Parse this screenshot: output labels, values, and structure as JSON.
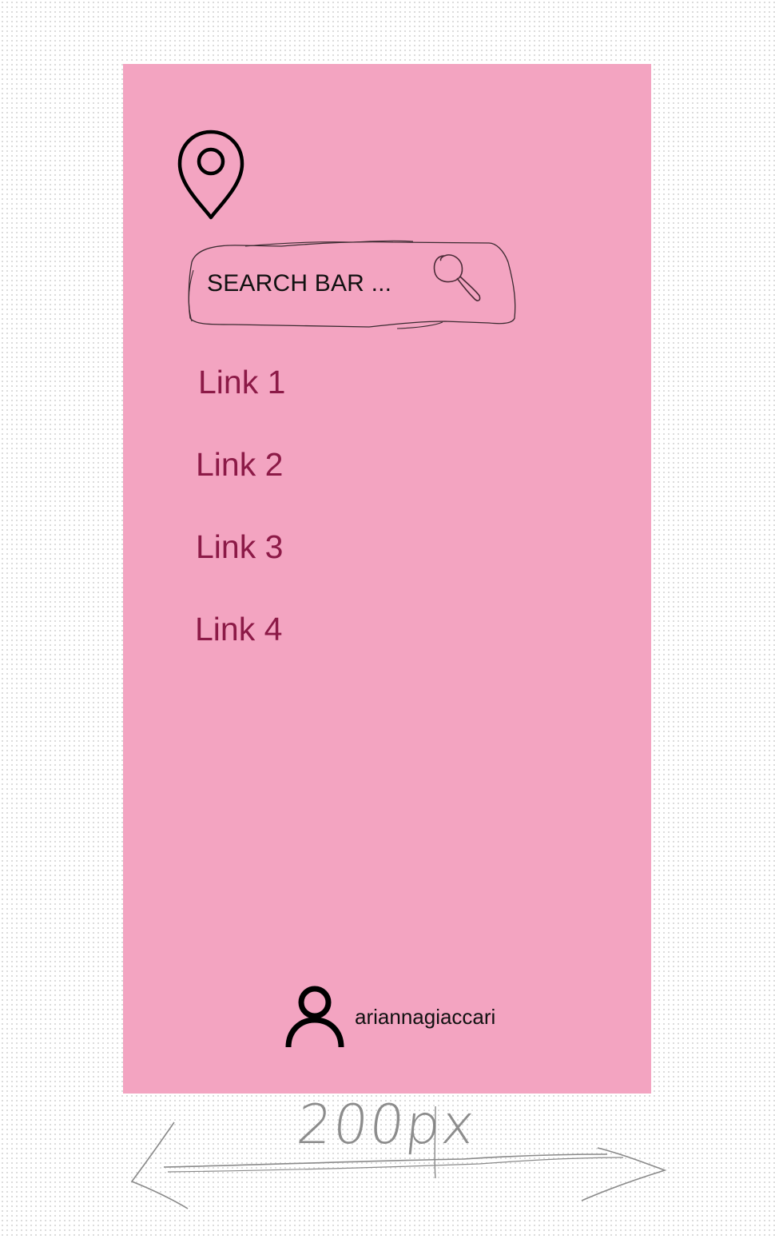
{
  "menu": {
    "background_color": "#f3a4c1",
    "logo_icon": "location-pin-icon",
    "search": {
      "placeholder": "SEARCH BAR ...",
      "icon": "magnifier-icon"
    },
    "links": [
      {
        "label": "Link 1"
      },
      {
        "label": "Link 2"
      },
      {
        "label": "Link 3"
      },
      {
        "label": "Link 4"
      }
    ],
    "link_color": "#8c1a47",
    "user": {
      "icon": "user-icon",
      "username": "ariannagiaccari"
    }
  },
  "annotation": {
    "width_label": "200px"
  }
}
